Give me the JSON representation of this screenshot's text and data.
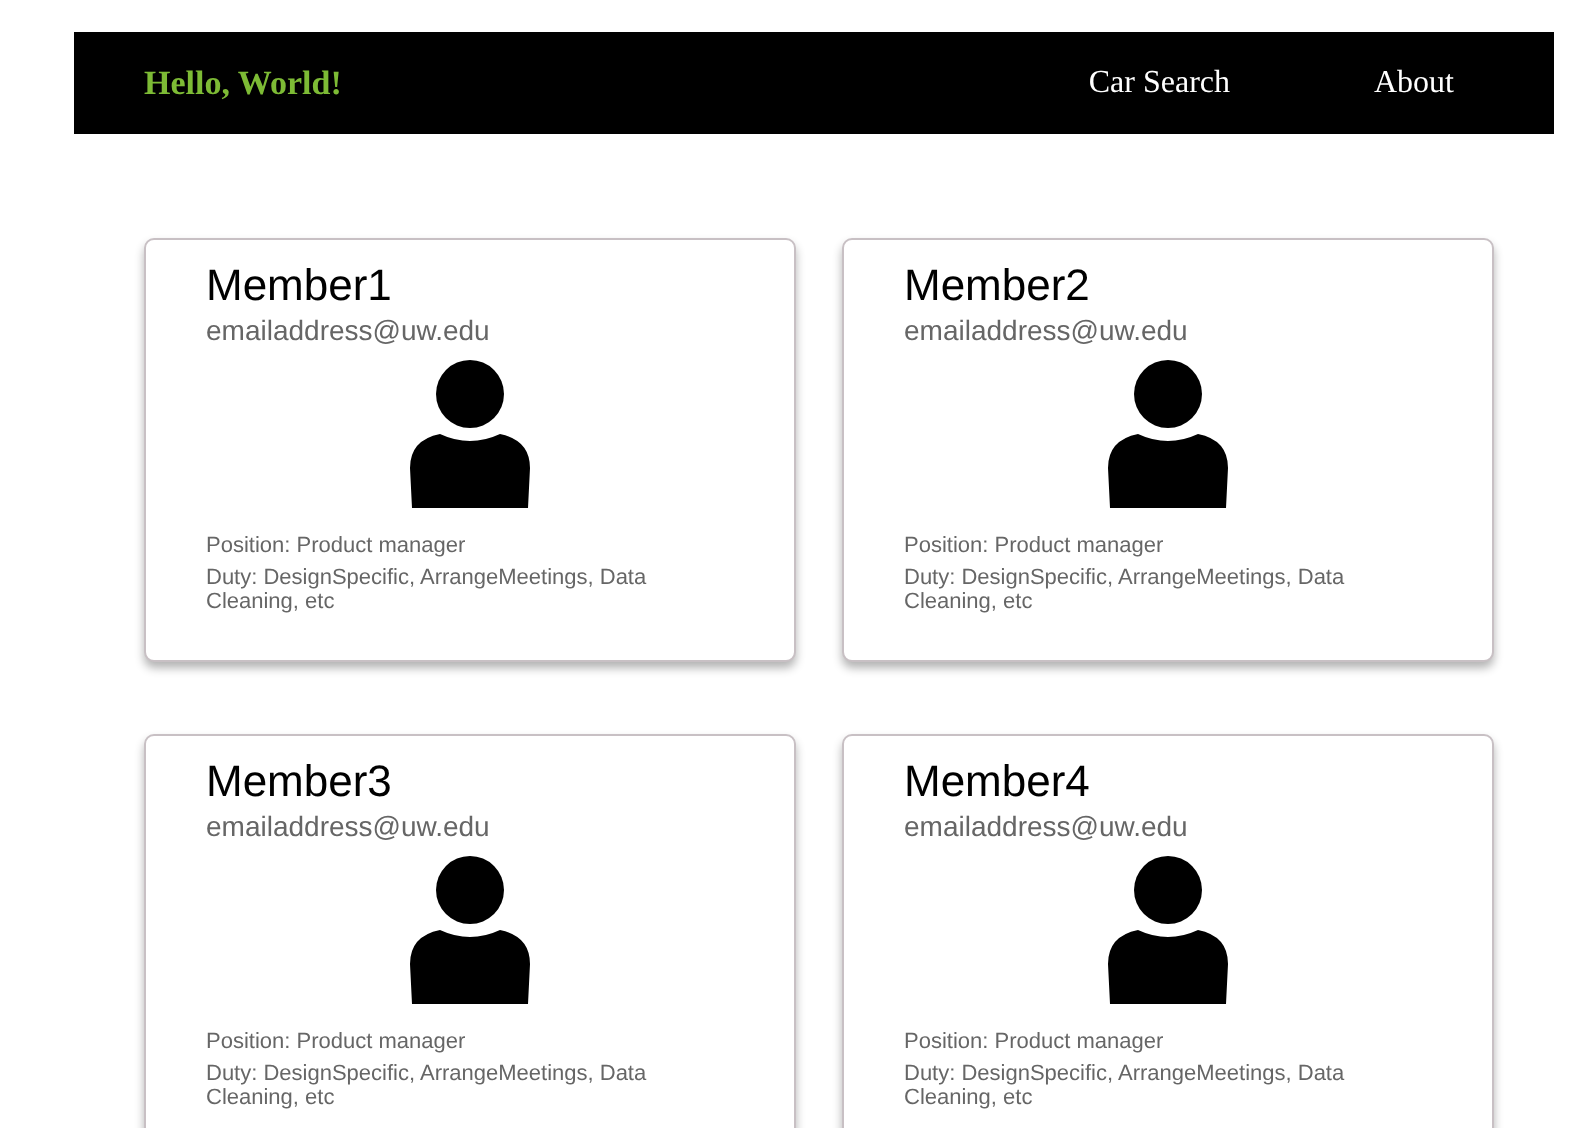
{
  "navbar": {
    "brand": "Hello, World!",
    "links": [
      "Car Search",
      "About"
    ]
  },
  "members": [
    {
      "name": "Member1",
      "email": "emailaddress@uw.edu",
      "position": "Position: Product manager",
      "duty": "Duty: DesignSpecific, ArrangeMeetings, Data Cleaning, etc"
    },
    {
      "name": "Member2",
      "email": "emailaddress@uw.edu",
      "position": "Position: Product manager",
      "duty": "Duty: DesignSpecific, ArrangeMeetings, Data Cleaning, etc"
    },
    {
      "name": "Member3",
      "email": "emailaddress@uw.edu",
      "position": "Position: Product manager",
      "duty": "Duty: DesignSpecific, ArrangeMeetings, Data Cleaning, etc"
    },
    {
      "name": "Member4",
      "email": "emailaddress@uw.edu",
      "position": "Position: Product manager",
      "duty": "Duty: DesignSpecific, ArrangeMeetings, Data Cleaning, etc"
    }
  ]
}
